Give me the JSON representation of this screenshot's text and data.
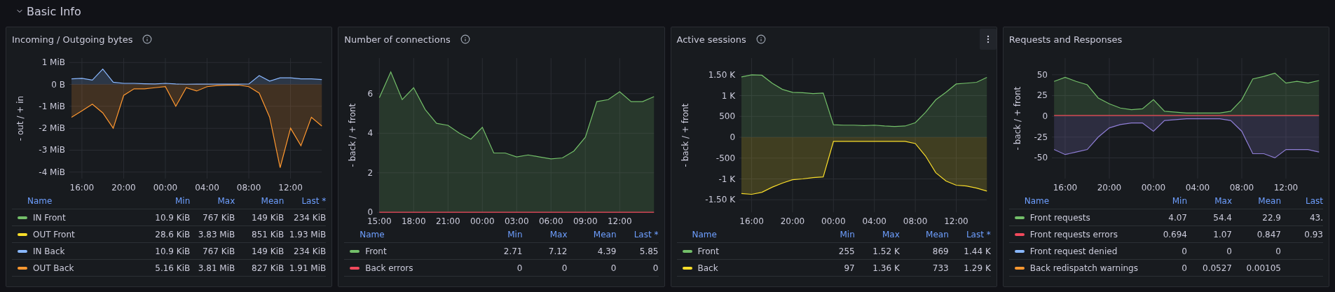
{
  "section": {
    "title": "Basic Info",
    "expanded": true
  },
  "panels": [
    {
      "title": "Incoming / Outgoing bytes",
      "info": true,
      "menu_visible": false,
      "chart_data": {
        "type": "area",
        "grid": true,
        "ylabel": "- out / + in",
        "categories": [
          null,
          "16:00",
          null,
          null,
          null,
          "20:00",
          null,
          null,
          null,
          "00:00",
          null,
          null,
          null,
          "04:00",
          null,
          null,
          null,
          "08:00",
          null,
          null,
          null,
          "12:00",
          null,
          null,
          null
        ],
        "ylim": [
          -4.3,
          1.2
        ],
        "yticks": [
          {
            "value": 1,
            "label": "1 MiB"
          },
          {
            "value": 0,
            "label": "0 B"
          },
          {
            "value": -1,
            "label": "-1 MiB"
          },
          {
            "value": -2,
            "label": "-2 MiB"
          },
          {
            "value": -3,
            "label": "-3 MiB"
          },
          {
            "value": -4,
            "label": "-4 MiB"
          }
        ],
        "series": [
          {
            "color": "#8ab8ff",
            "values": [
              0.25,
              0.28,
              0.2,
              0.7,
              0.1,
              0.05,
              0.05,
              0.03,
              0.02,
              0.05,
              0.02,
              0.01,
              0.01,
              0.01,
              0.01,
              0.01,
              0.01,
              0.02,
              0.4,
              0.15,
              0.3,
              0.3,
              0.25,
              0.25,
              0.22
            ]
          },
          {
            "color": "#ff9830",
            "values": [
              -1.5,
              -1.2,
              -0.9,
              -1.3,
              -2.0,
              -0.5,
              -0.2,
              -0.2,
              -0.15,
              -0.1,
              -1.0,
              -0.15,
              -0.3,
              -0.1,
              -0.05,
              -0.03,
              -0.03,
              -0.1,
              -0.4,
              -1.5,
              -3.8,
              -2.0,
              -2.8,
              -1.5,
              -1.9
            ]
          }
        ]
      },
      "legend": {
        "columns": [
          "Name",
          "Min",
          "Max",
          "Mean",
          "Last *"
        ],
        "rows": [
          {
            "name": "IN Front",
            "color": "#73bf69",
            "min": "10.9 KiB",
            "max": "767 KiB",
            "mean": "149 KiB",
            "last": "234 KiB"
          },
          {
            "name": "OUT Front",
            "color": "#fade2a",
            "min": "28.6 KiB",
            "max": "3.83 MiB",
            "mean": "851 KiB",
            "last": "1.93 MiB"
          },
          {
            "name": "IN Back",
            "color": "#8ab8ff",
            "min": "10.9 KiB",
            "max": "767 KiB",
            "mean": "149 KiB",
            "last": "234 KiB"
          },
          {
            "name": "OUT Back",
            "color": "#ff9830",
            "min": "5.16 KiB",
            "max": "3.81 MiB",
            "mean": "827 KiB",
            "last": "1.91 MiB"
          }
        ]
      }
    },
    {
      "title": "Number of connections",
      "info": true,
      "menu_visible": false,
      "chart_data": {
        "type": "area",
        "grid": true,
        "ylabel": "- back / + front",
        "categories": [
          "15:00",
          null,
          null,
          "18:00",
          null,
          null,
          "21:00",
          null,
          null,
          "00:00",
          null,
          null,
          "03:00",
          null,
          null,
          "06:00",
          null,
          null,
          "09:00",
          null,
          null,
          "12:00",
          null,
          null,
          null
        ],
        "ylim": [
          0,
          7.8
        ],
        "yticks": [
          0,
          2,
          4,
          6
        ],
        "series": [
          {
            "color": "#73bf69",
            "values": [
              5.8,
              7.1,
              5.7,
              6.3,
              5.2,
              4.5,
              4.4,
              4.0,
              3.7,
              4.3,
              3.0,
              3.0,
              2.8,
              2.9,
              2.8,
              2.7,
              2.75,
              3.1,
              3.8,
              5.6,
              5.7,
              6.1,
              5.6,
              5.6,
              5.85
            ]
          },
          {
            "type": "line",
            "color": "#f2495c",
            "values": [
              0,
              0,
              0,
              0,
              0,
              0,
              0,
              0,
              0,
              0,
              0,
              0,
              0,
              0,
              0,
              0,
              0,
              0,
              0,
              0,
              0,
              0,
              0,
              0,
              0
            ]
          }
        ]
      },
      "legend": {
        "columns": [
          "Name",
          "Min",
          "Max",
          "Mean",
          "Last *"
        ],
        "rows": [
          {
            "name": "Front",
            "color": "#73bf69",
            "min": "2.71",
            "max": "7.12",
            "mean": "4.39",
            "last": "5.85"
          },
          {
            "name": "Back errors",
            "color": "#f2495c",
            "min": "0",
            "max": "0",
            "mean": "0",
            "last": "0"
          }
        ]
      }
    },
    {
      "title": "Active sessions",
      "info": true,
      "menu_visible": true,
      "chart_data": {
        "type": "area",
        "ylabel": "- back / + front",
        "categories": [
          null,
          "16:00",
          null,
          null,
          null,
          "20:00",
          null,
          null,
          null,
          "00:00",
          null,
          null,
          null,
          "04:00",
          null,
          null,
          null,
          "08:00",
          null,
          null,
          null,
          "12:00",
          null,
          null,
          null
        ],
        "grid": true,
        "ylim": [
          -1800,
          1900
        ],
        "yticks": [
          {
            "value": 1500,
            "label": "1.50 K"
          },
          {
            "value": 1000,
            "label": "1 K"
          },
          {
            "value": 500,
            "label": "500"
          },
          {
            "value": 0,
            "label": "0"
          },
          {
            "value": -500,
            "label": "-500"
          },
          {
            "value": -1000,
            "label": "-1 K"
          },
          {
            "value": -1500,
            "label": "-1.50 K"
          }
        ],
        "series": [
          {
            "color": "#73bf69",
            "values": [
              1450,
              1500,
              1490,
              1300,
              1150,
              1080,
              1070,
              1050,
              1060,
              300,
              290,
              290,
              280,
              290,
              270,
              260,
              270,
              350,
              600,
              900,
              1080,
              1280,
              1300,
              1320,
              1440
            ]
          },
          {
            "color": "#fade2a",
            "values": [
              -1350,
              -1370,
              -1320,
              -1200,
              -1100,
              -1020,
              -1000,
              -970,
              -950,
              -100,
              -100,
              -100,
              -100,
              -100,
              -100,
              -100,
              -100,
              -150,
              -450,
              -850,
              -1050,
              -1150,
              -1170,
              -1220,
              -1290
            ]
          }
        ]
      },
      "legend": {
        "columns": [
          "Name",
          "Min",
          "Max",
          "Mean",
          "Last *"
        ],
        "rows": [
          {
            "name": "Front",
            "color": "#73bf69",
            "min": "255",
            "max": "1.52 K",
            "mean": "869",
            "last": "1.44 K"
          },
          {
            "name": "Back",
            "color": "#fade2a",
            "min": "97",
            "max": "1.36 K",
            "mean": "733",
            "last": "1.29 K"
          }
        ]
      }
    },
    {
      "title": "Requests and Responses",
      "info": false,
      "menu_visible": false,
      "chart_data": {
        "type": "area",
        "ylabel": "- back / + front",
        "categories": [
          null,
          "16:00",
          null,
          null,
          null,
          "20:00",
          null,
          null,
          null,
          "00:00",
          null,
          null,
          null,
          "04:00",
          null,
          null,
          null,
          "08:00",
          null,
          null,
          null,
          "12:00",
          null,
          null,
          null
        ],
        "grid": true,
        "ylim": [
          -75,
          70
        ],
        "yticks": [
          50,
          25,
          0,
          -25,
          -50
        ],
        "series": [
          {
            "color": "#73bf69",
            "values": [
              42,
              47,
              42,
              38,
              22,
              15,
              10,
              8,
              9,
              20,
              6,
              5,
              4,
              4,
              4,
              4,
              6,
              20,
              45,
              48,
              52,
              40,
              42,
              40,
              43
            ]
          },
          {
            "color": "#8f7ed6",
            "values": [
              -40,
              -46,
              -43,
              -40,
              -25,
              -14,
              -10,
              -8,
              -8,
              -18,
              -5,
              -4,
              -3,
              -3,
              -3,
              -3,
              -5,
              -18,
              -45,
              -45,
              -50,
              -40,
              -40,
              -40,
              -43
            ]
          },
          {
            "type": "line",
            "color": "#f2495c",
            "values": [
              1,
              1,
              1,
              1,
              1,
              1,
              1,
              1,
              1,
              1,
              1,
              1,
              1,
              1,
              1,
              1,
              1,
              1,
              1,
              1,
              1,
              1,
              1,
              1,
              1
            ]
          }
        ]
      },
      "legend": {
        "columns": [
          "Name",
          "Min",
          "Max",
          "Mean",
          "Last"
        ],
        "rows": [
          {
            "name": "Front requests",
            "color": "#73bf69",
            "min": "4.07",
            "max": "54.4",
            "mean": "22.9",
            "last": "43."
          },
          {
            "name": "Front requests errors",
            "color": "#f2495c",
            "min": "0.694",
            "max": "1.07",
            "mean": "0.847",
            "last": "0.93"
          },
          {
            "name": "Front request denied",
            "color": "#8ab8ff",
            "min": "0",
            "max": "0",
            "mean": "0"
          },
          {
            "name": "Back redispatch warnings",
            "color": "#ff9830",
            "min": "0",
            "max": "0.0527",
            "mean": "0.00105"
          }
        ]
      }
    }
  ]
}
